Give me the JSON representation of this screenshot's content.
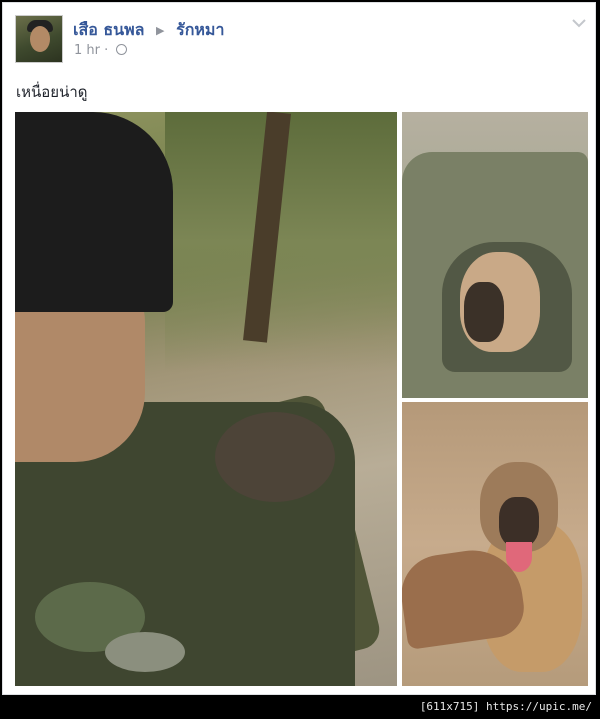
{
  "post": {
    "author": "เสือ ธนพล",
    "arrow": "▶",
    "target": "รักหมา",
    "time": "1 hr",
    "separator": "·",
    "text": "เหนื่อยน่าดู"
  },
  "icons": [
    "avatar",
    "privacy-globe-icon",
    "chevron-down-icon",
    "arrow-right-icon"
  ],
  "footer": {
    "watermark": "[611x715] https://upic.me/"
  },
  "colors": {
    "link": "#365899",
    "meta": "#90949c",
    "text": "#1d2129"
  }
}
